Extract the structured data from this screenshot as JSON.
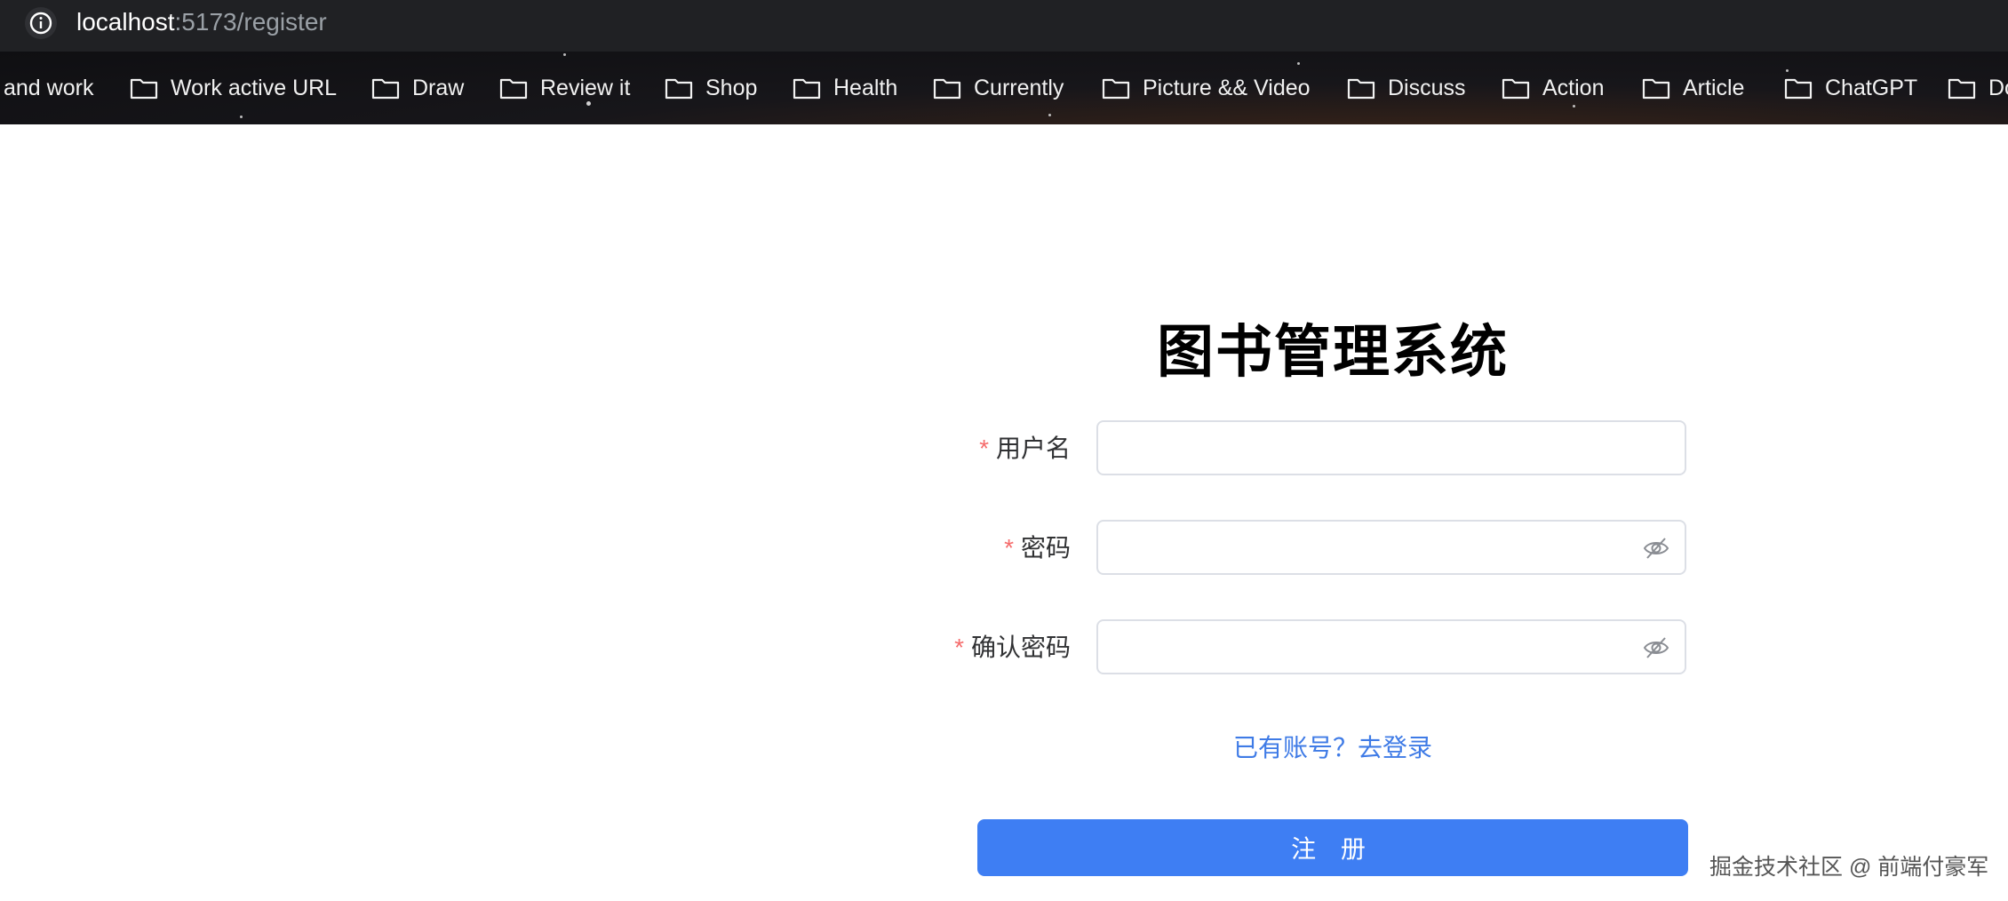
{
  "browser": {
    "url_host": "localhost",
    "url_path": ":5173/register",
    "icons": {
      "site_info": "info-icon",
      "bookmark_folder": "folder-icon"
    },
    "bookmarks": [
      {
        "label": "and work"
      },
      {
        "label": "Work active URL"
      },
      {
        "label": "Draw"
      },
      {
        "label": "Review it"
      },
      {
        "label": "Shop"
      },
      {
        "label": "Health"
      },
      {
        "label": "Currently"
      },
      {
        "label": "Picture && Video"
      },
      {
        "label": "Discuss"
      },
      {
        "label": "Action"
      },
      {
        "label": "Article"
      },
      {
        "label": "ChatGPT"
      },
      {
        "label": "Do"
      }
    ]
  },
  "form": {
    "title": "图书管理系统",
    "required_mark": "*",
    "fields": [
      {
        "label": "用户名",
        "value": "",
        "type": "text"
      },
      {
        "label": "密码",
        "value": "",
        "type": "password",
        "icon": "eye-off-icon"
      },
      {
        "label": "确认密码",
        "value": "",
        "type": "password",
        "icon": "eye-off-icon"
      }
    ],
    "login_link": "已有账号？去登录",
    "submit_label": "注 册"
  },
  "watermark": "掘金技术社区 @ 前端付豪军",
  "colors": {
    "primary": "#3e7ef3",
    "link": "#3f7be6",
    "required": "#f56c6c",
    "border": "#dcdfe6",
    "browser_bar": "#202124"
  }
}
